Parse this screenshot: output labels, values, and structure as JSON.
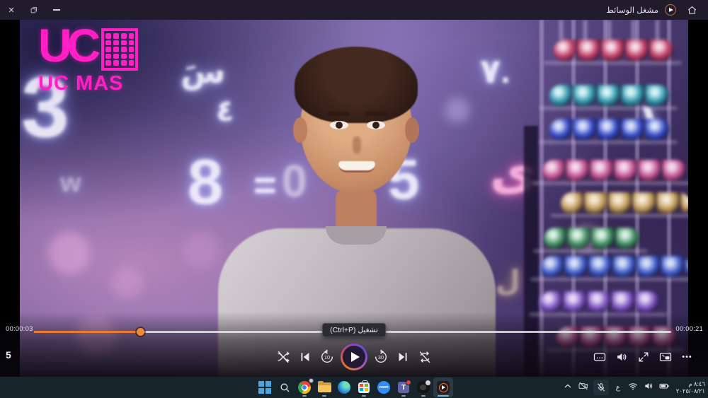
{
  "titlebar": {
    "title": "مشغل الوسائط"
  },
  "colors": {
    "accent_orange": "#e87d2e",
    "logo_magenta": "#ff1fc4",
    "active_underline": "#6cb8d8",
    "taskbar_bg": "#17242c"
  },
  "video": {
    "logo": {
      "monogram": "UC",
      "wordmark": "UC MAS"
    },
    "glow": [
      {
        "char": "3"
      },
      {
        "char": "سَ"
      },
      {
        "char": "٤"
      },
      {
        "char": "8"
      },
      {
        "char": "="
      },
      {
        "char": "0"
      },
      {
        "char": "5"
      },
      {
        "char": "٧."
      },
      {
        "char": "ى"
      },
      {
        "char": "١"
      },
      {
        "char": "w"
      },
      {
        "char": "ل"
      }
    ]
  },
  "player": {
    "elapsed": "00:00:03",
    "duration": "00:00:21",
    "tooltip": "تشغيل (Ctrl+P)",
    "skip_back_label": "10",
    "skip_forward_label": "30",
    "overlay_count": "5",
    "more_label": "•••"
  },
  "taskbar": {
    "zoom_label": "zoom",
    "teams_label": "T",
    "tray": {
      "language": "ع",
      "time": "٨:٤٦ م",
      "date": "٢٠٢٥/٠٨/٢١"
    }
  }
}
